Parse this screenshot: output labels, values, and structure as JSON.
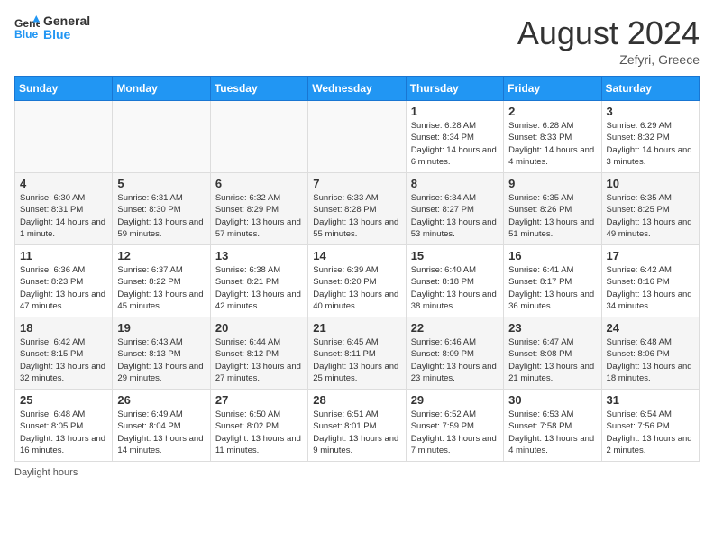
{
  "header": {
    "logo_line1": "General",
    "logo_line2": "Blue",
    "month_year": "August 2024",
    "location": "Zefyri, Greece"
  },
  "days_of_week": [
    "Sunday",
    "Monday",
    "Tuesday",
    "Wednesday",
    "Thursday",
    "Friday",
    "Saturday"
  ],
  "weeks": [
    [
      {
        "day": "",
        "empty": true
      },
      {
        "day": "",
        "empty": true
      },
      {
        "day": "",
        "empty": true
      },
      {
        "day": "",
        "empty": true
      },
      {
        "day": "1",
        "sunrise": "6:28 AM",
        "sunset": "8:34 PM",
        "daylight": "14 hours and 6 minutes."
      },
      {
        "day": "2",
        "sunrise": "6:28 AM",
        "sunset": "8:33 PM",
        "daylight": "14 hours and 4 minutes."
      },
      {
        "day": "3",
        "sunrise": "6:29 AM",
        "sunset": "8:32 PM",
        "daylight": "14 hours and 3 minutes."
      }
    ],
    [
      {
        "day": "4",
        "sunrise": "6:30 AM",
        "sunset": "8:31 PM",
        "daylight": "14 hours and 1 minute."
      },
      {
        "day": "5",
        "sunrise": "6:31 AM",
        "sunset": "8:30 PM",
        "daylight": "13 hours and 59 minutes."
      },
      {
        "day": "6",
        "sunrise": "6:32 AM",
        "sunset": "8:29 PM",
        "daylight": "13 hours and 57 minutes."
      },
      {
        "day": "7",
        "sunrise": "6:33 AM",
        "sunset": "8:28 PM",
        "daylight": "13 hours and 55 minutes."
      },
      {
        "day": "8",
        "sunrise": "6:34 AM",
        "sunset": "8:27 PM",
        "daylight": "13 hours and 53 minutes."
      },
      {
        "day": "9",
        "sunrise": "6:35 AM",
        "sunset": "8:26 PM",
        "daylight": "13 hours and 51 minutes."
      },
      {
        "day": "10",
        "sunrise": "6:35 AM",
        "sunset": "8:25 PM",
        "daylight": "13 hours and 49 minutes."
      }
    ],
    [
      {
        "day": "11",
        "sunrise": "6:36 AM",
        "sunset": "8:23 PM",
        "daylight": "13 hours and 47 minutes."
      },
      {
        "day": "12",
        "sunrise": "6:37 AM",
        "sunset": "8:22 PM",
        "daylight": "13 hours and 45 minutes."
      },
      {
        "day": "13",
        "sunrise": "6:38 AM",
        "sunset": "8:21 PM",
        "daylight": "13 hours and 42 minutes."
      },
      {
        "day": "14",
        "sunrise": "6:39 AM",
        "sunset": "8:20 PM",
        "daylight": "13 hours and 40 minutes."
      },
      {
        "day": "15",
        "sunrise": "6:40 AM",
        "sunset": "8:18 PM",
        "daylight": "13 hours and 38 minutes."
      },
      {
        "day": "16",
        "sunrise": "6:41 AM",
        "sunset": "8:17 PM",
        "daylight": "13 hours and 36 minutes."
      },
      {
        "day": "17",
        "sunrise": "6:42 AM",
        "sunset": "8:16 PM",
        "daylight": "13 hours and 34 minutes."
      }
    ],
    [
      {
        "day": "18",
        "sunrise": "6:42 AM",
        "sunset": "8:15 PM",
        "daylight": "13 hours and 32 minutes."
      },
      {
        "day": "19",
        "sunrise": "6:43 AM",
        "sunset": "8:13 PM",
        "daylight": "13 hours and 29 minutes."
      },
      {
        "day": "20",
        "sunrise": "6:44 AM",
        "sunset": "8:12 PM",
        "daylight": "13 hours and 27 minutes."
      },
      {
        "day": "21",
        "sunrise": "6:45 AM",
        "sunset": "8:11 PM",
        "daylight": "13 hours and 25 minutes."
      },
      {
        "day": "22",
        "sunrise": "6:46 AM",
        "sunset": "8:09 PM",
        "daylight": "13 hours and 23 minutes."
      },
      {
        "day": "23",
        "sunrise": "6:47 AM",
        "sunset": "8:08 PM",
        "daylight": "13 hours and 21 minutes."
      },
      {
        "day": "24",
        "sunrise": "6:48 AM",
        "sunset": "8:06 PM",
        "daylight": "13 hours and 18 minutes."
      }
    ],
    [
      {
        "day": "25",
        "sunrise": "6:48 AM",
        "sunset": "8:05 PM",
        "daylight": "13 hours and 16 minutes."
      },
      {
        "day": "26",
        "sunrise": "6:49 AM",
        "sunset": "8:04 PM",
        "daylight": "13 hours and 14 minutes."
      },
      {
        "day": "27",
        "sunrise": "6:50 AM",
        "sunset": "8:02 PM",
        "daylight": "13 hours and 11 minutes."
      },
      {
        "day": "28",
        "sunrise": "6:51 AM",
        "sunset": "8:01 PM",
        "daylight": "13 hours and 9 minutes."
      },
      {
        "day": "29",
        "sunrise": "6:52 AM",
        "sunset": "7:59 PM",
        "daylight": "13 hours and 7 minutes."
      },
      {
        "day": "30",
        "sunrise": "6:53 AM",
        "sunset": "7:58 PM",
        "daylight": "13 hours and 4 minutes."
      },
      {
        "day": "31",
        "sunrise": "6:54 AM",
        "sunset": "7:56 PM",
        "daylight": "13 hours and 2 minutes."
      }
    ]
  ],
  "footer": {
    "daylight_label": "Daylight hours"
  }
}
